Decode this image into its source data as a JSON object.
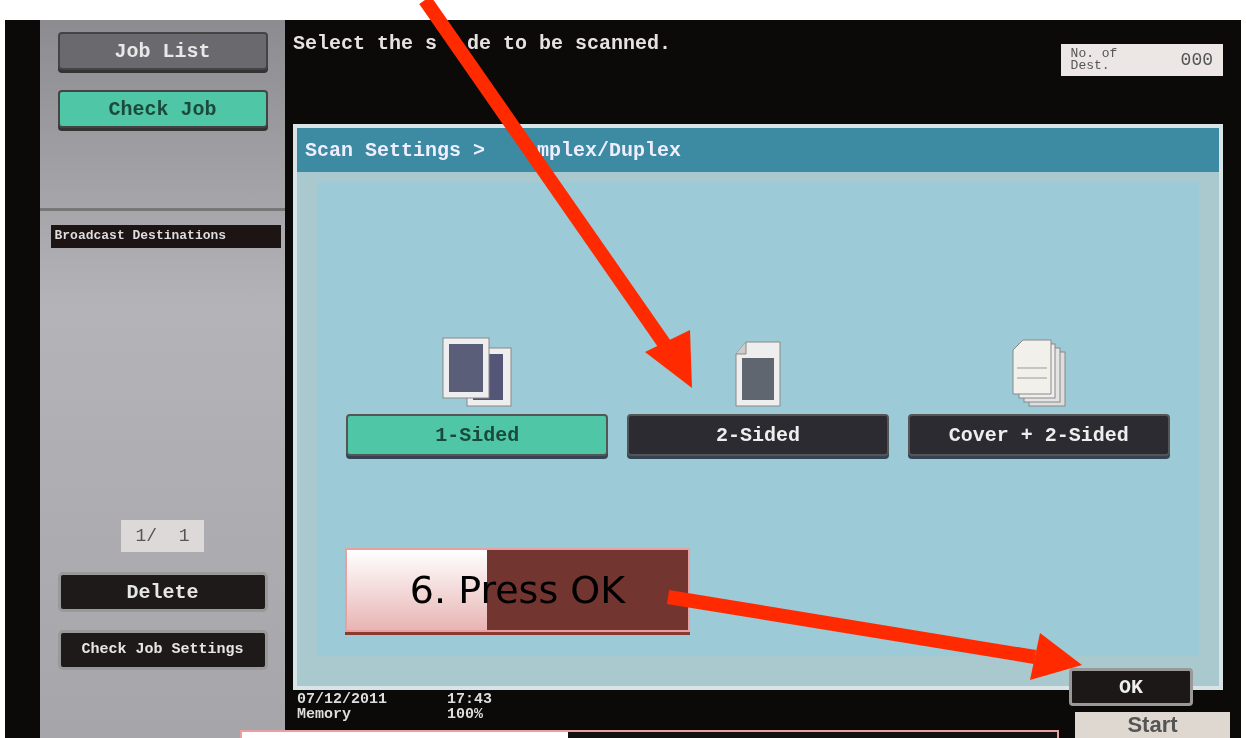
{
  "sidebar": {
    "buttons": [
      {
        "label": "Job List",
        "selected": false
      },
      {
        "label": "Check Job",
        "selected": true
      }
    ],
    "list_header": "Broadcast Destinations",
    "page": "1/  1",
    "actions": [
      "Delete",
      "Check Job Settings"
    ]
  },
  "message": [
    "Select the s",
    "de to be scanned."
  ],
  "destinations": {
    "label": "No. of Dest.",
    "count": "000"
  },
  "dialog": {
    "breadcrumb": [
      "Scan Settings >",
      "mplex/Duplex"
    ],
    "options": [
      {
        "label": "1-Sided",
        "kind": "one-sided",
        "selected": true
      },
      {
        "label": "2-Sided",
        "kind": "two-sided",
        "selected": false
      },
      {
        "label": "Cover + 2-Sided",
        "kind": "cover",
        "selected": false
      }
    ],
    "ok": "OK"
  },
  "status": {
    "date": "07/12/2011",
    "time": "17:43",
    "memory_label": "Memory",
    "memory": "100%"
  },
  "start_button": "Start",
  "callout": {
    "text": "6. Press OK"
  }
}
